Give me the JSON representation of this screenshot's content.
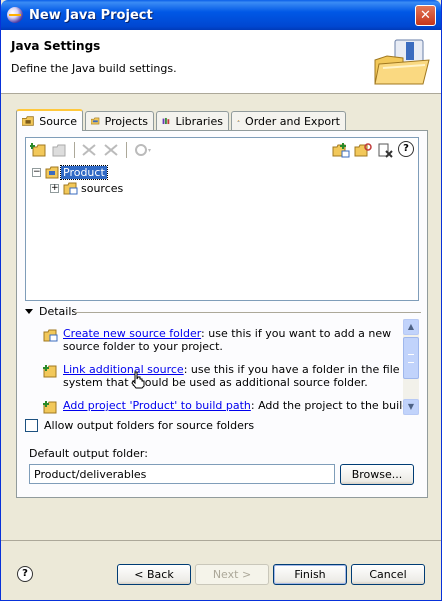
{
  "window": {
    "title": "New Java Project",
    "close_glyph": "✕"
  },
  "header": {
    "title": "Java Settings",
    "description": "Define the Java build settings.",
    "image_icon": "java-project-wizard-icon"
  },
  "tabs": [
    {
      "label": "Source",
      "icon": "source-folder-icon",
      "active": true
    },
    {
      "label": "Projects",
      "icon": "projects-icon",
      "active": false
    },
    {
      "label": "Libraries",
      "icon": "libraries-icon",
      "active": false
    },
    {
      "label": "Order and Export",
      "icon": "order-export-icon",
      "active": false
    }
  ],
  "tree": {
    "nodes": [
      {
        "label": "Product",
        "expander": "⊟",
        "selected": true
      },
      {
        "label": "sources",
        "expander": "⊞",
        "selected": false
      }
    ]
  },
  "details": {
    "label": "Details",
    "items": [
      {
        "link": "Create new source folder",
        "text": ": use this if you want to add a new source folder to your project."
      },
      {
        "link": "Link additional source",
        "text": ": use this if you have a folder in the file system that should be used as additional source folder."
      },
      {
        "link": "Add project 'Product' to build path",
        "text": ": Add the project to the build path if"
      }
    ]
  },
  "options": {
    "allow_output_label": "Allow output folders for source folders",
    "default_output_label": "Default output folder:",
    "default_output_value": "Product/deliverables",
    "browse_label": "Browse..."
  },
  "buttons": {
    "back": "< Back",
    "next": "Next >",
    "finish": "Finish",
    "cancel": "Cancel",
    "help": "?"
  },
  "colors": {
    "titlebar": "#0058e6",
    "selection": "#316ac5",
    "link": "#0000ee",
    "dialog_bg": "#ece9d8"
  }
}
